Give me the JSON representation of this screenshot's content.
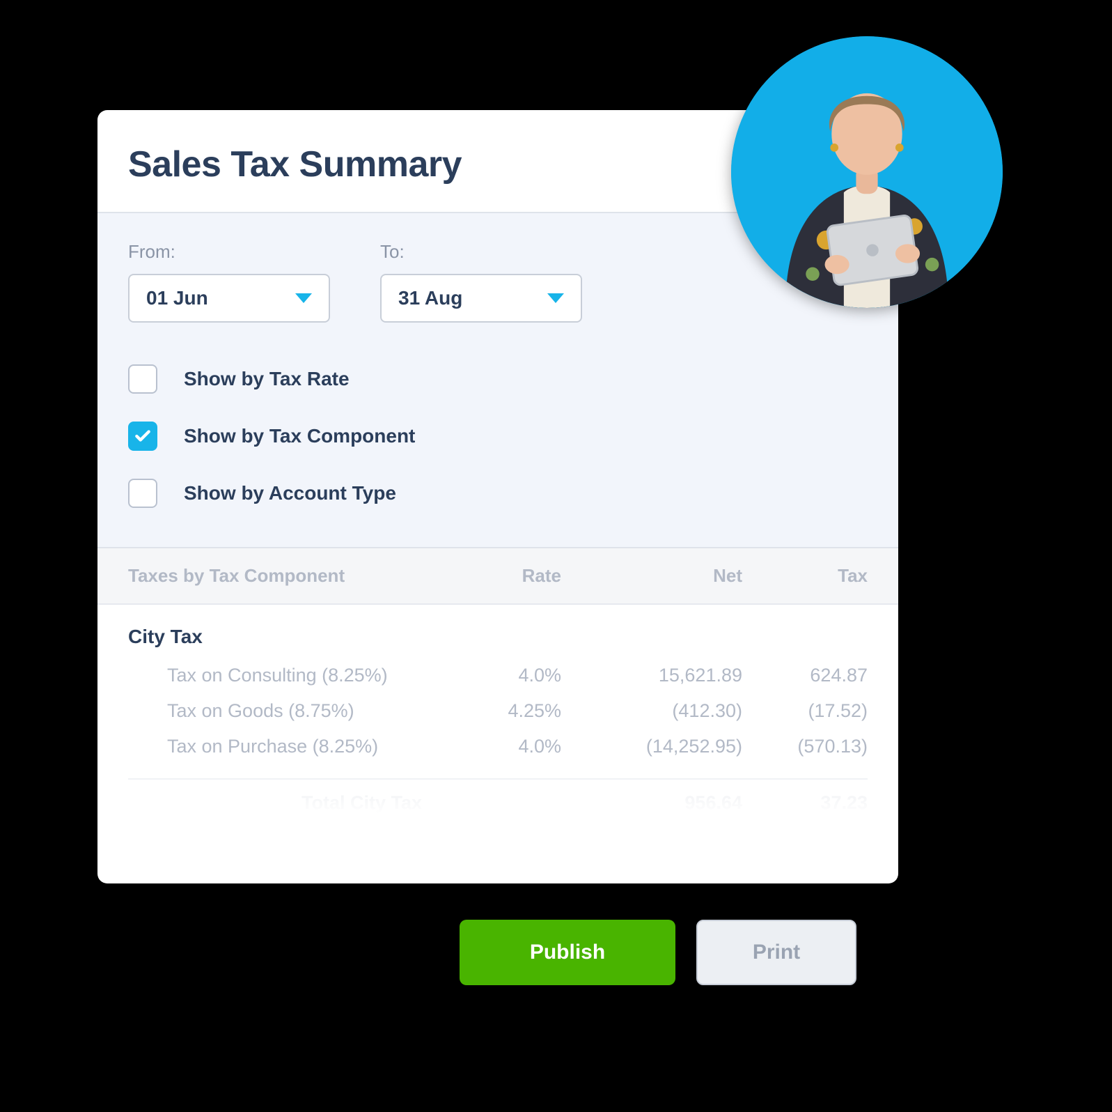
{
  "header": {
    "title": "Sales Tax Summary"
  },
  "filters": {
    "from_label": "From:",
    "to_label": "To:",
    "from_value": "01 Jun",
    "to_value": "31 Aug",
    "options": [
      {
        "label": "Show by Tax Rate",
        "checked": false
      },
      {
        "label": "Show by Tax Component",
        "checked": true
      },
      {
        "label": "Show by Account Type",
        "checked": false
      }
    ]
  },
  "table": {
    "columns": {
      "name": "Taxes by Tax Component",
      "rate": "Rate",
      "net": "Net",
      "tax": "Tax"
    },
    "group_title": "City Tax",
    "rows": [
      {
        "name": "Tax on Consulting (8.25%)",
        "rate": "4.0%",
        "net": "15,621.89",
        "tax": "624.87"
      },
      {
        "name": "Tax on Goods (8.75%)",
        "rate": "4.25%",
        "net": "(412.30)",
        "tax": "(17.52)"
      },
      {
        "name": "Tax on Purchase (8.25%)",
        "rate": "4.0%",
        "net": "(14,252.95)",
        "tax": "(570.13)"
      }
    ],
    "total": {
      "label": "Total City Tax",
      "net": "956.64",
      "tax": "37.23"
    }
  },
  "actions": {
    "publish": "Publish",
    "print": "Print"
  },
  "avatar": {
    "alt": "Accountant holding a tablet"
  }
}
